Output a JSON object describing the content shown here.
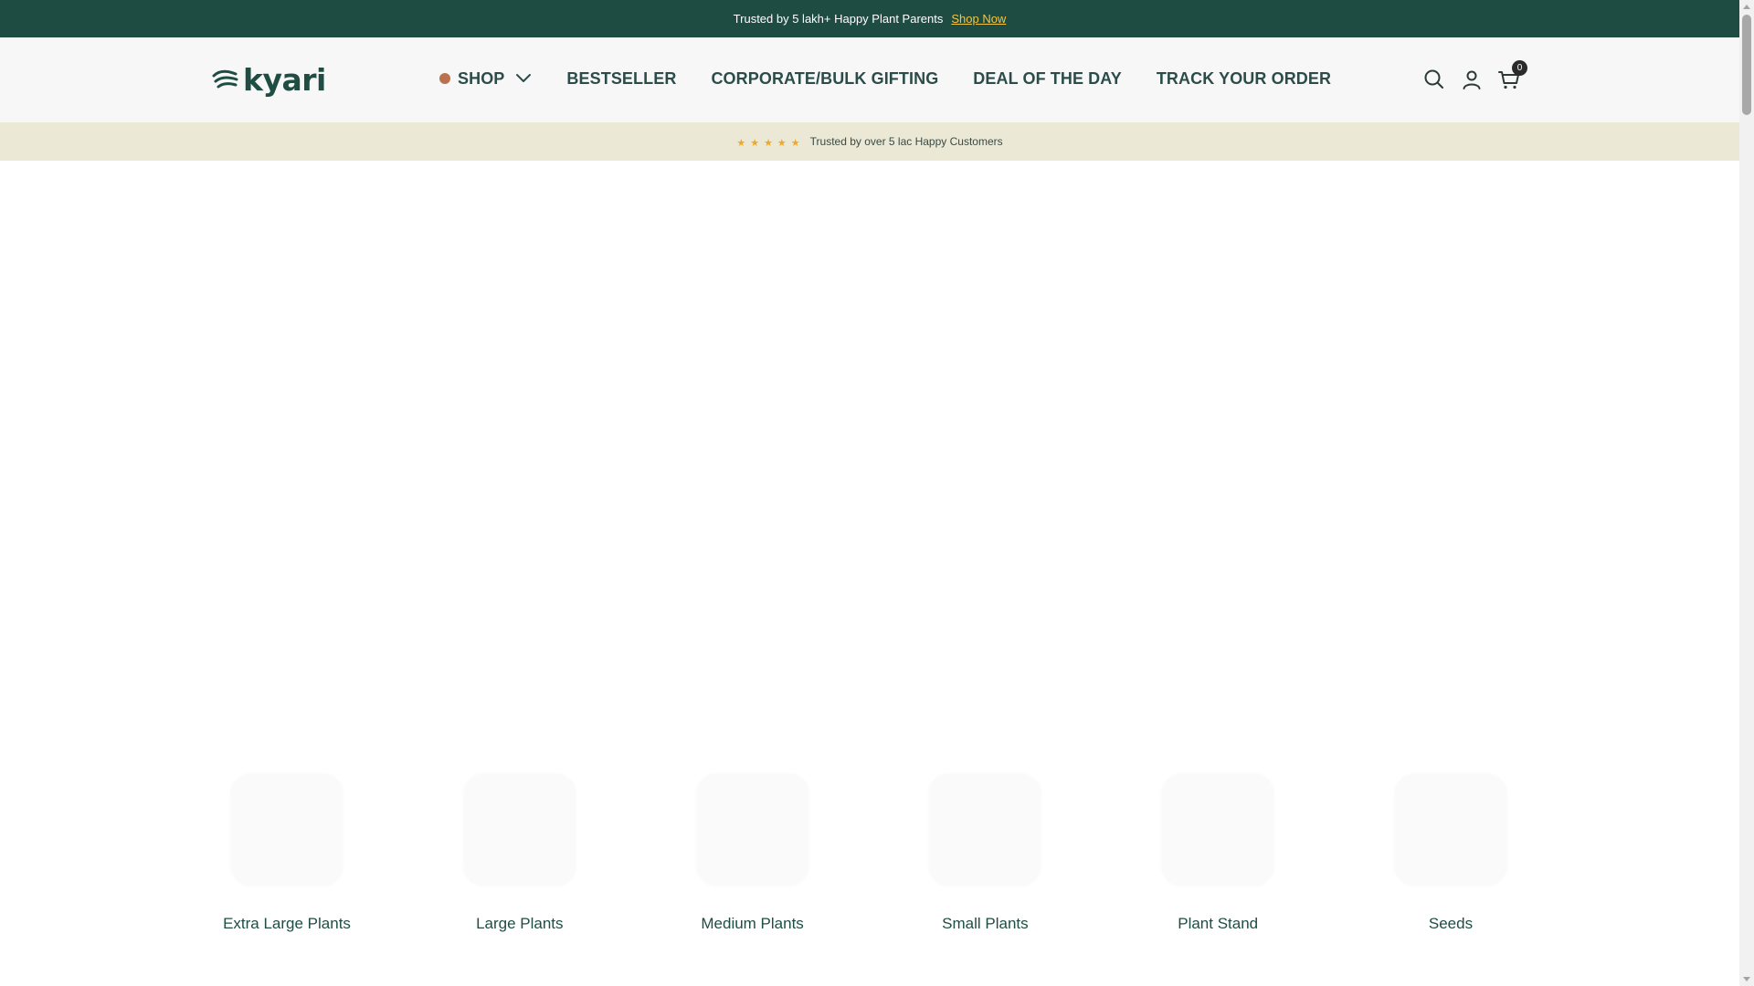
{
  "announcement": {
    "text": "Trusted by 5 lakh+ Happy Plant Parents",
    "link": "Shop Now"
  },
  "header": {
    "logo_text": "kyari",
    "nav": {
      "shop": "SHOP",
      "bestseller": "BESTSELLER",
      "corporate": "CORPORATE/BULK GIFTING",
      "deal": "DEAL OF THE DAY",
      "track": "TRACK YOUR ORDER"
    },
    "icons": [
      "search-icon",
      "account-icon",
      "cart-icon"
    ],
    "cart_count": "0"
  },
  "trust_bar": {
    "stars": "★★★★★",
    "text": "Trusted by over 5 lac Happy Customers"
  },
  "categories": [
    {
      "label": "Extra Large Plants"
    },
    {
      "label": "Large Plants"
    },
    {
      "label": "Medium Plants"
    },
    {
      "label": "Small Plants"
    },
    {
      "label": "Plant Stand"
    },
    {
      "label": "Seeds"
    }
  ],
  "colors": {
    "brand_green": "#1e4c42",
    "accent_yellow": "#f4c542",
    "shop_dot": "#b9724d",
    "trust_bg": "#ebe8d6",
    "star": "#f0a825"
  }
}
